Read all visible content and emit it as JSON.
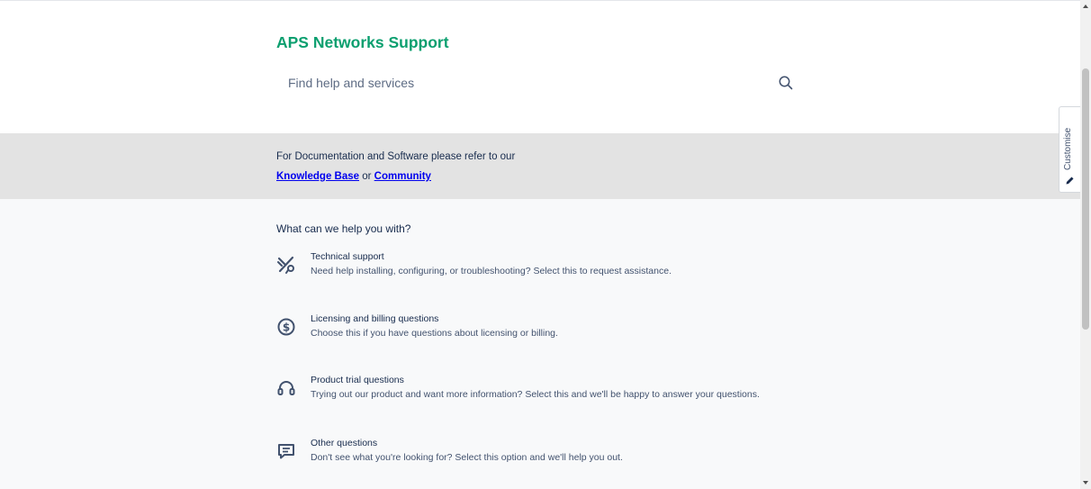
{
  "header": {
    "title": "APS Networks Support",
    "search_placeholder": "Find help and services",
    "search_icon": "search-icon"
  },
  "banner": {
    "line1": "For Documentation and Software please refer to our",
    "kb_link": "Knowledge Base",
    "or_text": "or",
    "community_link": "Community"
  },
  "main": {
    "question": "What can we help you with?",
    "options": [
      {
        "icon": "tools-icon",
        "title": "Technical support",
        "description": "Need help installing, configuring, or troubleshooting? Select this to request assistance."
      },
      {
        "icon": "dollar-icon",
        "title": "Licensing and billing questions",
        "description": "Choose this if you have questions about licensing or billing."
      },
      {
        "icon": "headset-icon",
        "title": "Product trial questions",
        "description": "Trying out our product and want more information? Select this and we'll be happy to answer your questions."
      },
      {
        "icon": "chat-icon",
        "title": "Other questions",
        "description": "Don't see what you're looking for? Select this option and we'll help you out."
      }
    ]
  },
  "customise": {
    "label": "Customise",
    "icon": "pencil-icon"
  },
  "colors": {
    "brand": "#0b9f6f",
    "link": "#0000ee",
    "banner_bg": "#e3e3e3",
    "page_bg": "#f8f9fa"
  }
}
